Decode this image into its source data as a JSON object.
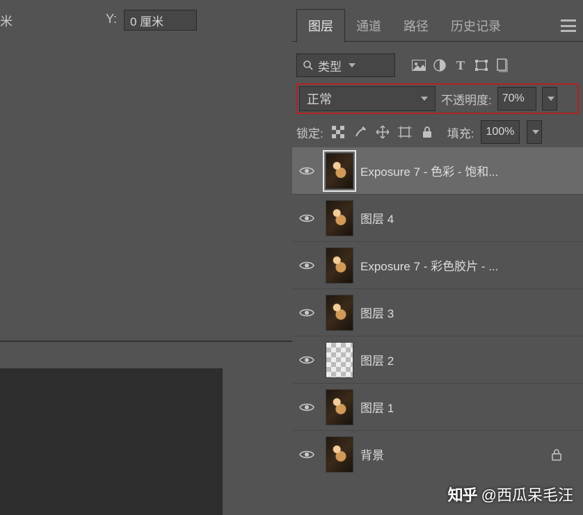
{
  "top": {
    "unit_fragment": "   米",
    "y_label": "Y:",
    "y_value": "0 厘米"
  },
  "panel": {
    "tabs": [
      "图层",
      "通道",
      "路径",
      "历史记录"
    ],
    "active_tab": 0,
    "filter": {
      "kind_label": "类型"
    },
    "blend": {
      "mode": "正常",
      "opacity_label": "不透明度:",
      "opacity_value": "70%"
    },
    "lock": {
      "label": "锁定:",
      "fill_label": "填充:",
      "fill_value": "100%"
    },
    "layers": [
      {
        "name": "Exposure 7 - 色彩 - 饱和...",
        "selected": true,
        "visible": true,
        "thumb": "img"
      },
      {
        "name": "图层 4",
        "selected": false,
        "visible": true,
        "thumb": "img"
      },
      {
        "name": "Exposure 7 - 彩色胶片 - ...",
        "selected": false,
        "visible": true,
        "thumb": "img"
      },
      {
        "name": "图层 3",
        "selected": false,
        "visible": true,
        "thumb": "img"
      },
      {
        "name": "图层 2",
        "selected": false,
        "visible": true,
        "thumb": "transparent"
      },
      {
        "name": "图层 1",
        "selected": false,
        "visible": true,
        "thumb": "img"
      },
      {
        "name": "背景",
        "selected": false,
        "visible": true,
        "thumb": "img",
        "locked": true
      }
    ]
  },
  "watermark": {
    "logo": "知乎",
    "text": "@西瓜呆毛汪"
  }
}
